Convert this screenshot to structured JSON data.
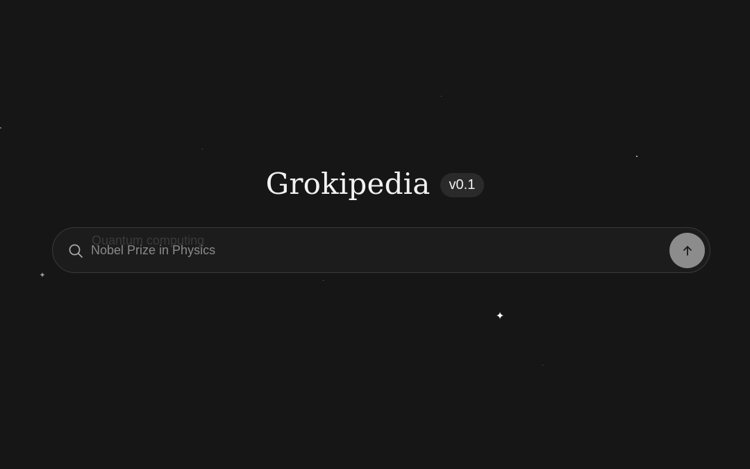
{
  "brand": {
    "title": "Grokipedia",
    "version": "v0.1"
  },
  "search": {
    "placeholder": "Nobel Prize in Physics",
    "placeholder_previous": "Quantum computing",
    "value": ""
  },
  "icons": {
    "search": "search-icon",
    "submit": "arrow-up-icon",
    "sparkle": "sparkle-icon"
  },
  "colors": {
    "background": "#161616",
    "search_bg": "#1c1c1c",
    "search_border": "#3a3a3a",
    "submit_button": "#8c8c8c",
    "badge_bg": "#2a2a2a",
    "title_text": "#f2f2f2",
    "placeholder_text": "#8a8a8a"
  }
}
